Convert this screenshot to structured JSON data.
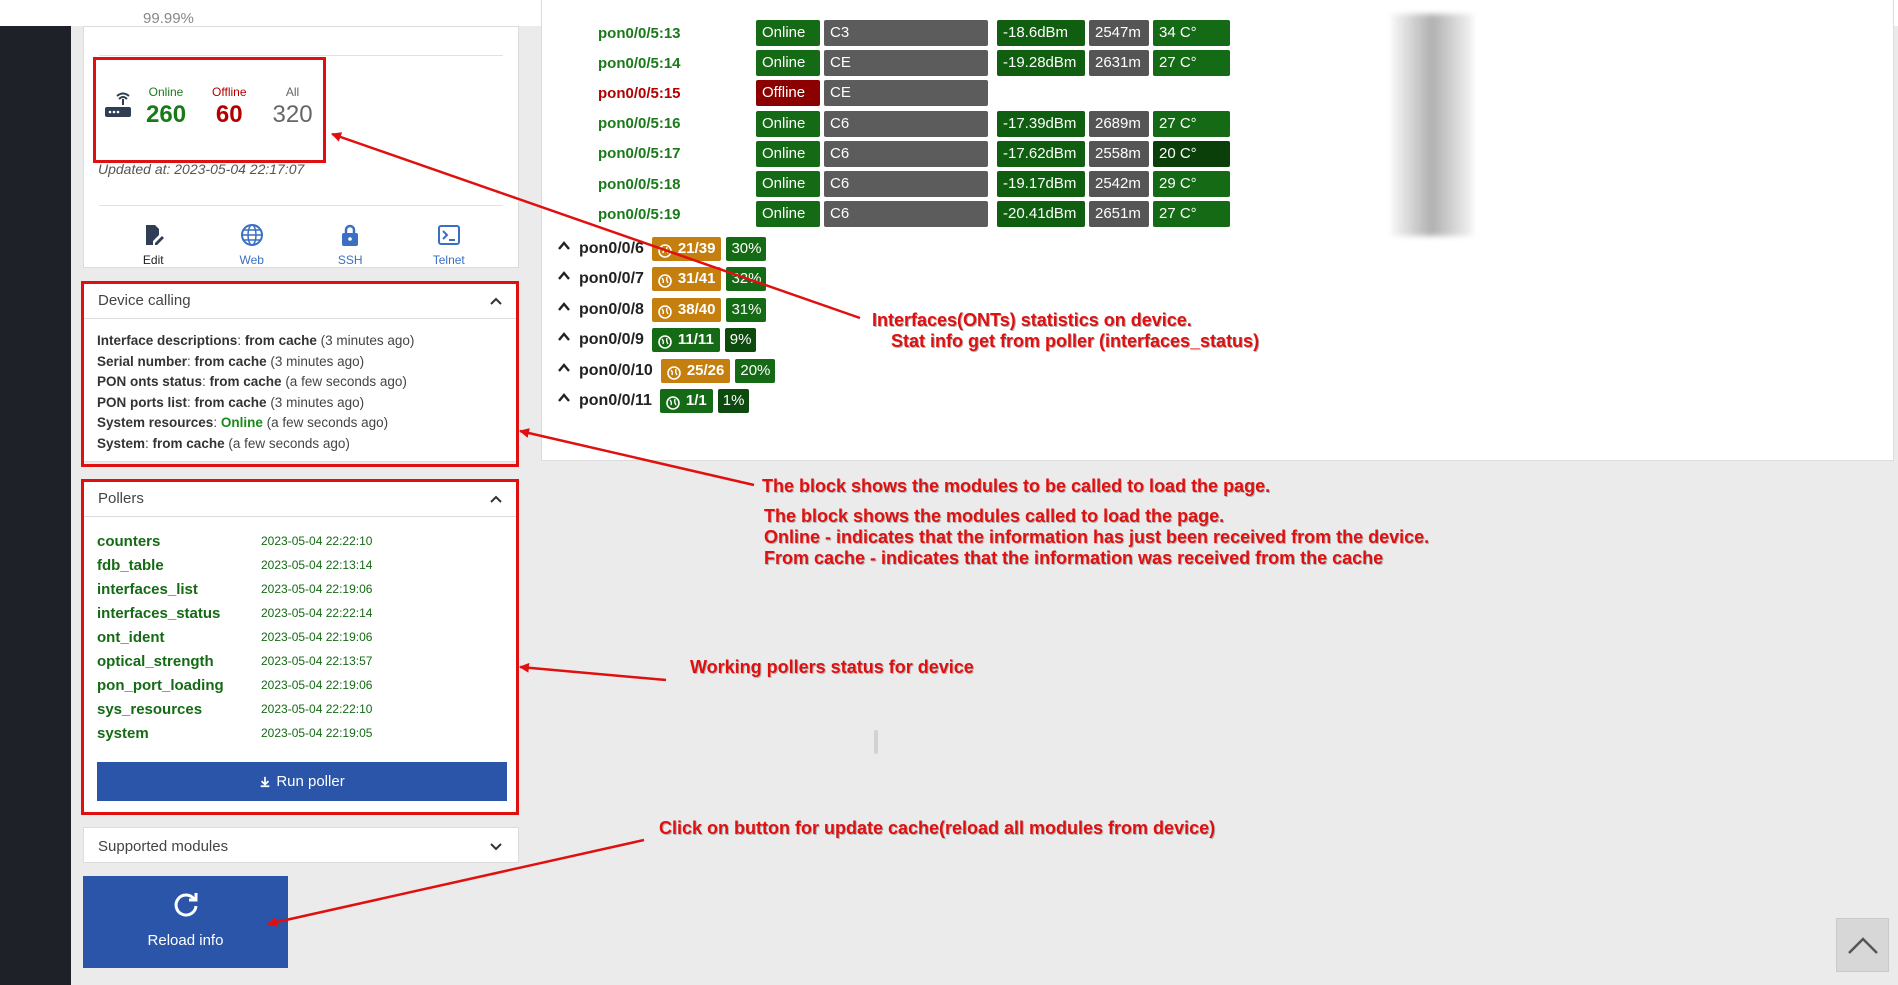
{
  "top": {
    "cut_text": "99.99%"
  },
  "stats": {
    "online_label": "Online",
    "online_value": "260",
    "offline_label": "Offline",
    "offline_value": "60",
    "all_label": "All",
    "all_value": "320",
    "updated": "Updated at: 2023-05-04 22:17:07"
  },
  "actions": {
    "edit": "Edit",
    "web": "Web",
    "ssh": "SSH",
    "telnet": "Telnet"
  },
  "calling": {
    "title": "Device calling",
    "items": [
      {
        "key": "Interface descriptions",
        "sep": ": ",
        "source": "from cache",
        "age": " (3 minutes ago)",
        "online": false
      },
      {
        "key": "Serial number",
        "sep": ": ",
        "source": "from cache",
        "age": " (3 minutes ago)",
        "online": false
      },
      {
        "key": "PON onts status",
        "sep": ": ",
        "source": "from cache",
        "age": " (a few seconds ago)",
        "online": false
      },
      {
        "key": "PON ports list",
        "sep": ": ",
        "source": "from cache",
        "age": " (3 minutes ago)",
        "online": false
      },
      {
        "key": "System resources",
        "sep": ": ",
        "source": "Online",
        "age": " (a few seconds ago)",
        "online": true
      },
      {
        "key": "System",
        "sep": ": ",
        "source": "from cache",
        "age": " (a few seconds ago)",
        "online": false
      }
    ]
  },
  "pollers": {
    "title": "Pollers",
    "items": [
      {
        "name": "counters",
        "time": "2023-05-04 22:22:10"
      },
      {
        "name": "fdb_table",
        "time": "2023-05-04 22:13:14"
      },
      {
        "name": "interfaces_list",
        "time": "2023-05-04 22:19:06"
      },
      {
        "name": "interfaces_status",
        "time": "2023-05-04 22:22:14"
      },
      {
        "name": "ont_ident",
        "time": "2023-05-04 22:19:06"
      },
      {
        "name": "optical_strength",
        "time": "2023-05-04 22:13:57"
      },
      {
        "name": "pon_port_loading",
        "time": "2023-05-04 22:19:06"
      },
      {
        "name": "sys_resources",
        "time": "2023-05-04 22:22:10"
      },
      {
        "name": "system",
        "time": "2023-05-04 22:19:05"
      }
    ],
    "run_label": "Run poller"
  },
  "supported": {
    "title": "Supported modules"
  },
  "reload": {
    "label": "Reload info"
  },
  "onts": [
    {
      "name": "pon0/0/5:13",
      "status": "Online",
      "serial": "C3",
      "signal": "-18.6dBm",
      "dist": "2547m",
      "temp": "34 C°",
      "online": true,
      "temp_dark": false
    },
    {
      "name": "pon0/0/5:14",
      "status": "Online",
      "serial": "CE",
      "signal": "-19.28dBm",
      "dist": "2631m",
      "temp": "27 C°",
      "online": true,
      "temp_dark": false
    },
    {
      "name": "pon0/0/5:15",
      "status": "Offline",
      "serial": "CE",
      "signal": "",
      "dist": "",
      "temp": "",
      "online": false,
      "temp_dark": false
    },
    {
      "name": "pon0/0/5:16",
      "status": "Online",
      "serial": "C6",
      "signal": "-17.39dBm",
      "dist": "2689m",
      "temp": "27 C°",
      "online": true,
      "temp_dark": false
    },
    {
      "name": "pon0/0/5:17",
      "status": "Online",
      "serial": "C6",
      "signal": "-17.62dBm",
      "dist": "2558m",
      "temp": "20 C°",
      "online": true,
      "temp_dark": true
    },
    {
      "name": "pon0/0/5:18",
      "status": "Online",
      "serial": "C6",
      "signal": "-19.17dBm",
      "dist": "2542m",
      "temp": "29 C°",
      "online": true,
      "temp_dark": false
    },
    {
      "name": "pon0/0/5:19",
      "status": "Online",
      "serial": "C6",
      "signal": "-20.41dBm",
      "dist": "2651m",
      "temp": "27 C°",
      "online": true,
      "temp_dark": false
    }
  ],
  "ports": [
    {
      "name": "pon0/0/6",
      "count": "21/39",
      "pct": "30%",
      "full": false
    },
    {
      "name": "pon0/0/7",
      "count": "31/41",
      "pct": "32%",
      "full": false
    },
    {
      "name": "pon0/0/8",
      "count": "38/40",
      "pct": "31%",
      "full": false
    },
    {
      "name": "pon0/0/9",
      "count": "11/11",
      "pct": "9%",
      "full": true
    },
    {
      "name": "pon0/0/10",
      "count": "25/26",
      "pct": "20%",
      "full": false
    },
    {
      "name": "pon0/0/11",
      "count": "1/1",
      "pct": "1%",
      "full": true
    }
  ],
  "annotations": {
    "interfaces_line1": "Interfaces(ONTs) statistics on device.",
    "interfaces_line2": "Stat info get from poller (interfaces_status)",
    "modules": "The block shows the modules to be called to load the page.",
    "called_line1": "The block shows the modules called to load the page.",
    "called_line2": "Online - indicates that the information has just been received from the device.",
    "called_line3": "From cache - indicates that the information was received from the cache",
    "pollers": "Working pollers status for device",
    "reload": "Click on button for update cache(reload all modules from device)"
  },
  "colors": {
    "online": "#1a7a1a",
    "offline": "#b30000",
    "annotation": "#e01010",
    "button": "#2a55a8"
  }
}
